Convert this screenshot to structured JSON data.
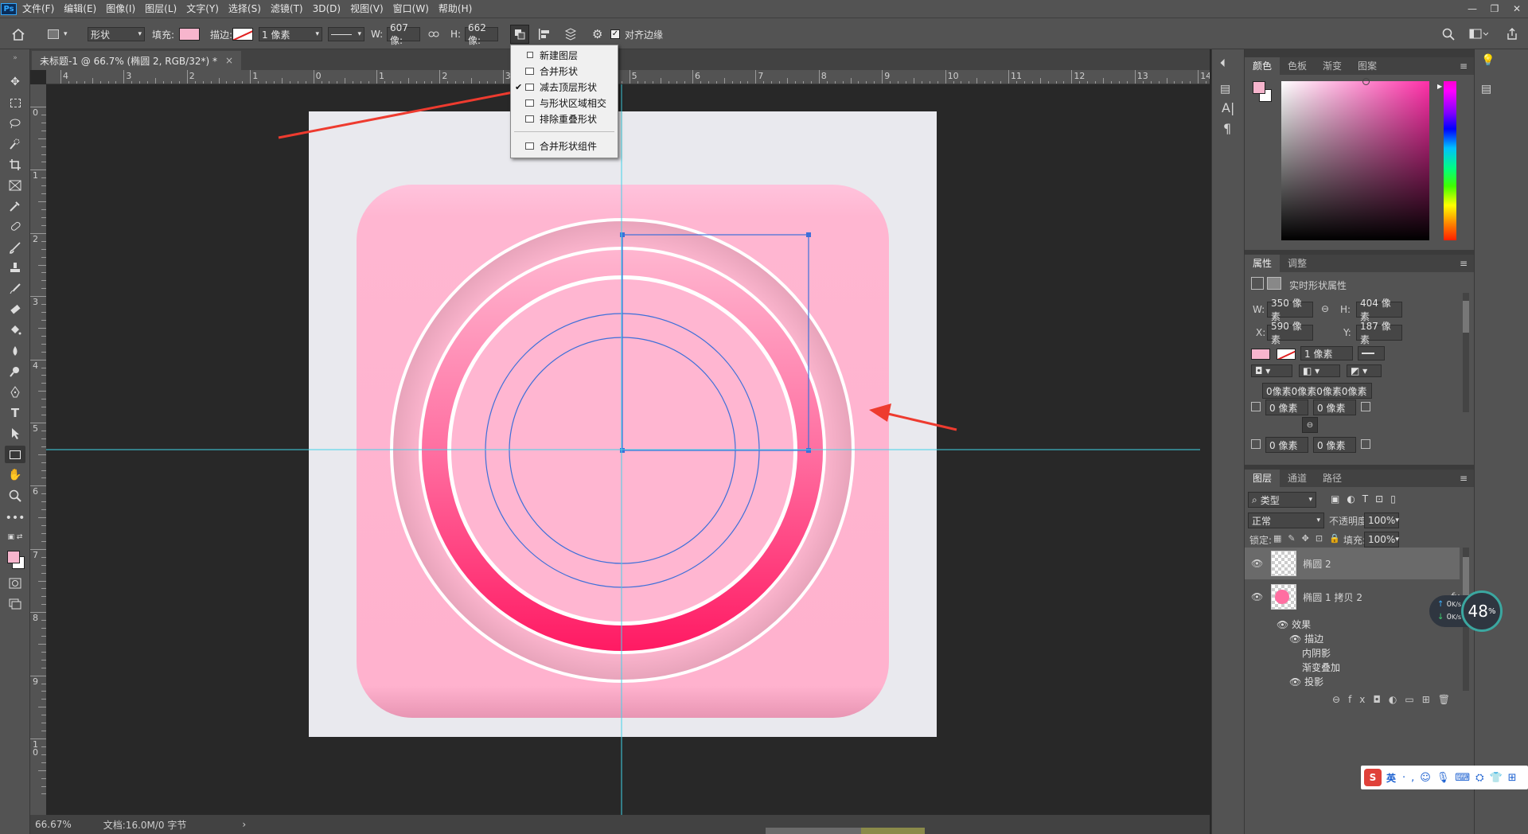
{
  "app": {
    "logo": "Ps"
  },
  "menu": [
    "文件(F)",
    "编辑(E)",
    "图像(I)",
    "图层(L)",
    "文字(Y)",
    "选择(S)",
    "滤镜(T)",
    "3D(D)",
    "视图(V)",
    "窗口(W)",
    "帮助(H)"
  ],
  "options": {
    "mode": "形状",
    "fill_label": "填充:",
    "stroke_label": "描边:",
    "stroke_width": "1 像素",
    "w_label": "W:",
    "w_value": "607 像:",
    "h_label": "H:",
    "h_value": "662 像:",
    "align_edges": "对齐边缘",
    "fill_color": "#f7b5cd"
  },
  "path_ops_menu": {
    "items": [
      "新建图层",
      "合并形状",
      "减去顶层形状",
      "与形状区域相交",
      "排除重叠形状",
      "合并形状组件"
    ],
    "checked_index": 2
  },
  "document": {
    "tab_title": "未标题-1 @ 66.7% (椭圆 2, RGB/32*) *",
    "close_glyph": "×"
  },
  "rulers": {
    "top": [
      "4",
      "3",
      "2",
      "1",
      "0",
      "1",
      "2",
      "3",
      "4",
      "5",
      "6",
      "7",
      "8",
      "9",
      "10",
      "11",
      "12",
      "13",
      "14"
    ],
    "left": [
      "0",
      "1",
      "2",
      "3",
      "4",
      "5",
      "6",
      "7",
      "8",
      "9",
      "1\n0"
    ]
  },
  "status": {
    "zoom": "66.67%",
    "doc": "文档:16.0M/0 字节",
    "arrow": "›"
  },
  "color_panel": {
    "tabs": [
      "颜色",
      "色板",
      "渐变",
      "图案"
    ],
    "fg": "#f7b5cd",
    "bg": "#ffffff"
  },
  "properties_panel": {
    "tabs": [
      "属性",
      "调整"
    ],
    "subtitle": "实时形状属性",
    "w_label": "W:",
    "w": "350 像素",
    "h_label": "H:",
    "h": "404 像素",
    "x_label": "X:",
    "x": "590 像素",
    "y_label": "Y:",
    "y": "187 像素",
    "stroke": "1 像素",
    "corners_summary": "0像素0像素0像素0像素",
    "c1": "0 像素",
    "c2": "0 像素",
    "c3": "0 像素",
    "c4": "0 像素"
  },
  "layers_panel": {
    "tabs": [
      "图层",
      "通道",
      "路径"
    ],
    "kind": "类型",
    "blend": "正常",
    "opacity_label": "不透明度:",
    "opacity": "100%",
    "lock_label": "锁定:",
    "fill_label": "填充:",
    "fill": "100%",
    "layers": [
      {
        "name": "椭圆 2",
        "selected": true
      },
      {
        "name": "椭圆 1 拷贝 2",
        "fx": "fx",
        "selected": false
      }
    ],
    "effects_header": "效果",
    "effects": [
      "描边",
      "内阴影",
      "渐变叠加",
      "投影"
    ]
  },
  "network_widget": {
    "up": "0",
    "down": "0",
    "unit": "K/s",
    "percent": "48",
    "percent_sign": "%"
  },
  "ime": {
    "lang": "英"
  }
}
